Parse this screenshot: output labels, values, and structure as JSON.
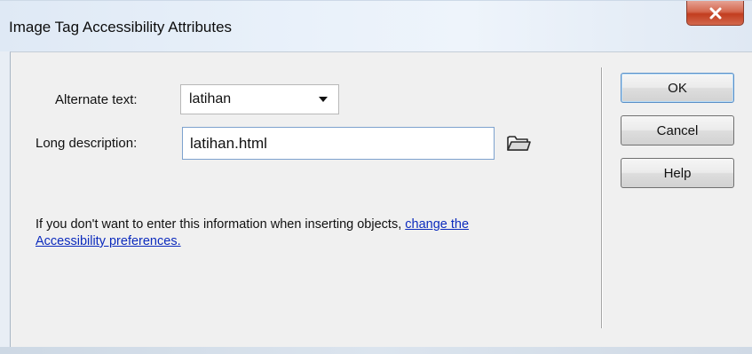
{
  "dialog": {
    "title": "Image Tag Accessibility Attributes"
  },
  "form": {
    "alt_text": {
      "label": "Alternate text:",
      "value": "latihan"
    },
    "long_description": {
      "label": "Long description:",
      "value": "latihan.html"
    }
  },
  "info": {
    "text": "If you don't want to enter this information when inserting objects,",
    "link": "change the Accessibility preferences."
  },
  "buttons": {
    "ok": "OK",
    "cancel": "Cancel",
    "help": "Help"
  },
  "icons": {
    "close": "close-icon",
    "browse": "folder-icon"
  },
  "colors": {
    "close_button": "#c7452a",
    "link": "#0c2bbd",
    "default_button_border": "#5a8fc7"
  }
}
